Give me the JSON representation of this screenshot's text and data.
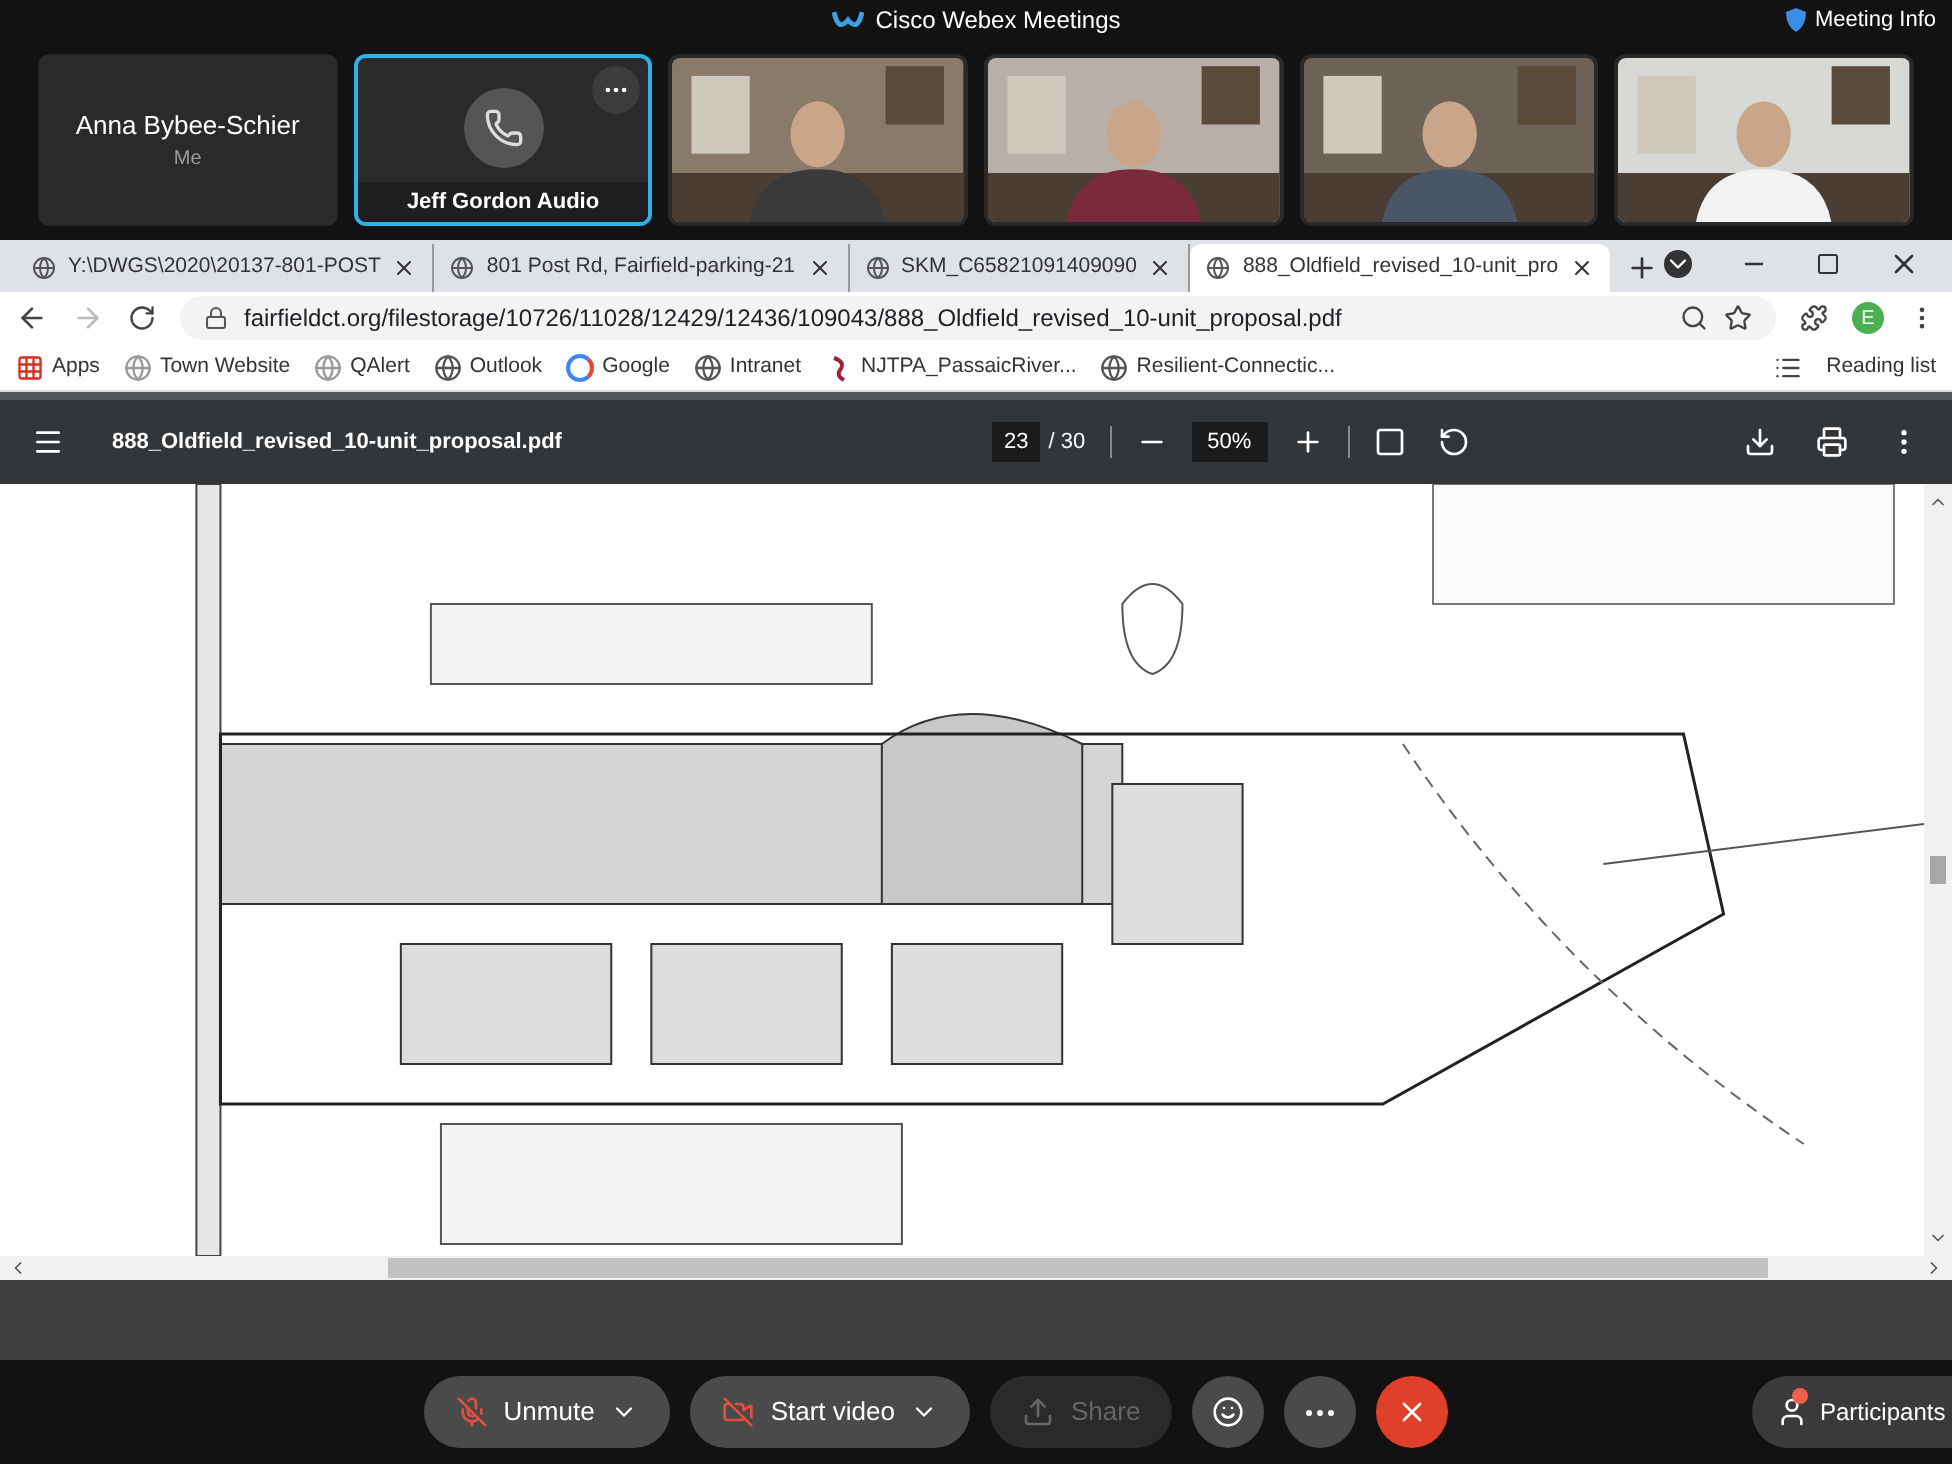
{
  "app": {
    "title": "Cisco Webex Meetings",
    "meeting_info": "Meeting Info"
  },
  "participants": [
    {
      "kind": "self",
      "name": "Anna Bybee-Schier",
      "subtitle": "Me",
      "selected": false
    },
    {
      "kind": "audio",
      "name": "Jeff Gordon Audio",
      "selected": true
    },
    {
      "kind": "video",
      "selected": false
    },
    {
      "kind": "video",
      "selected": false
    },
    {
      "kind": "video",
      "selected": false
    },
    {
      "kind": "video",
      "selected": false
    }
  ],
  "browser": {
    "tabs": [
      {
        "title": "Y:\\DWGS\\2020\\20137-801-POST",
        "selected": false
      },
      {
        "title": "801 Post Rd, Fairfield-parking-21",
        "selected": false
      },
      {
        "title": "SKM_C65821091409090",
        "selected": false
      },
      {
        "title": "888_Oldfield_revised_10-unit_pro",
        "selected": true
      }
    ],
    "address": "fairfieldct.org/filestorage/10726/11028/12429/12436/109043/888_Oldfield_revised_10-unit_proposal.pdf",
    "profile": "E",
    "bookmarks": [
      {
        "kind": "apps",
        "label": "Apps"
      },
      {
        "kind": "globe",
        "label": "Town Website"
      },
      {
        "kind": "globe",
        "label": "QAlert"
      },
      {
        "kind": "world",
        "label": "Outlook"
      },
      {
        "kind": "google",
        "label": "Google"
      },
      {
        "kind": "world",
        "label": "Intranet"
      },
      {
        "kind": "njtpa",
        "label": "NJTPA_PassaicRiver..."
      },
      {
        "kind": "world",
        "label": "Resilient-Connectic..."
      }
    ],
    "reading_list": "Reading list"
  },
  "pdf_viewer": {
    "filename": "888_Oldfield_revised_10-unit_proposal.pdf",
    "page": "23",
    "page_total": "/ 30",
    "zoom": "50%"
  },
  "controls": [
    {
      "kind": "mute",
      "label": "Unmute",
      "disabled": false,
      "dropdown": true
    },
    {
      "kind": "video",
      "label": "Start video",
      "disabled": false,
      "dropdown": true
    },
    {
      "kind": "share",
      "label": "Share",
      "disabled": true,
      "dropdown": false
    }
  ],
  "participants_button": {
    "label": "Participants",
    "alert": true
  }
}
